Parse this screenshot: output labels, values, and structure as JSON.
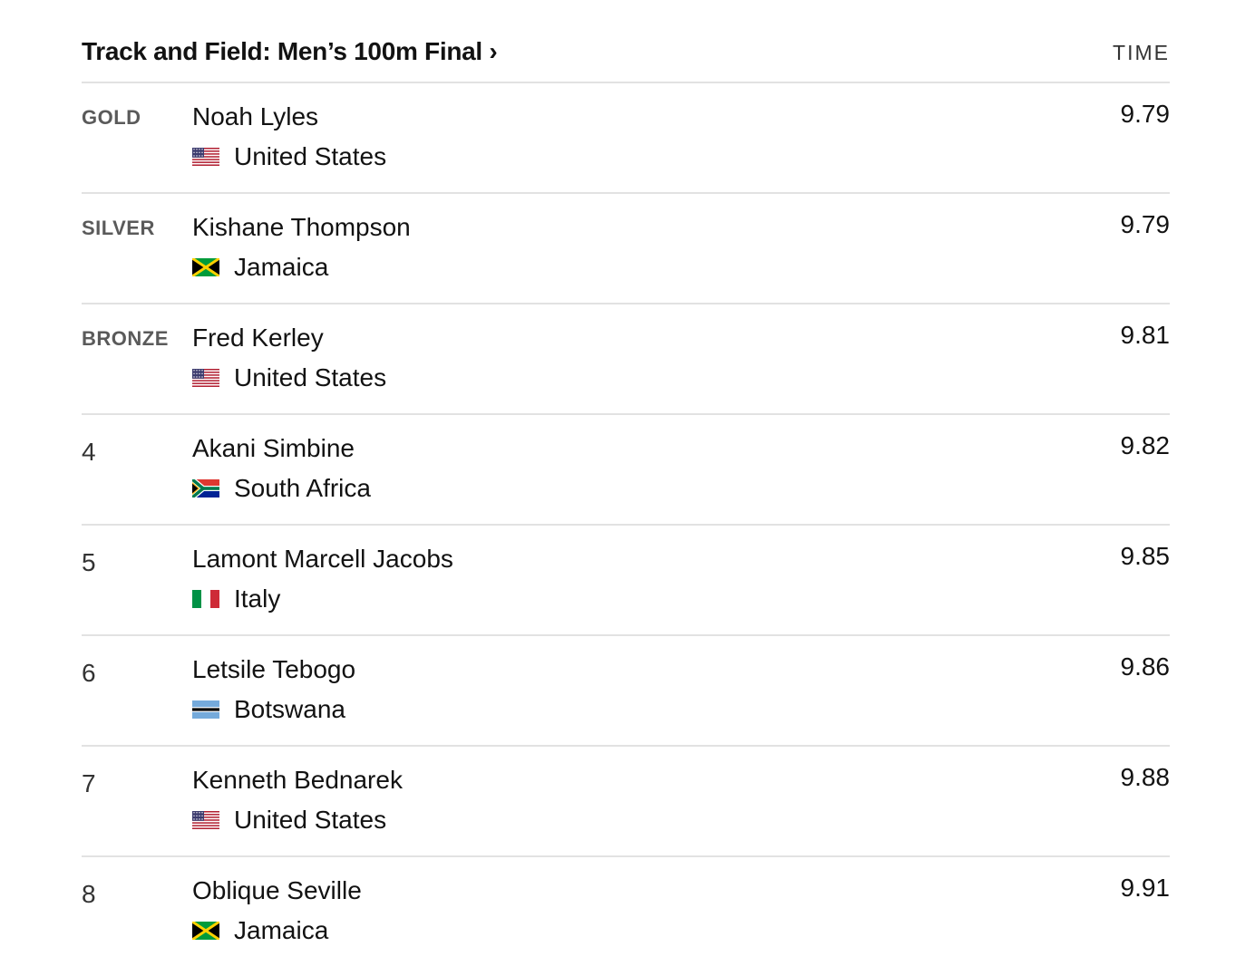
{
  "header": {
    "title": "Track and Field: Men’s 100m Final ›",
    "time_label": "TIME"
  },
  "results": [
    {
      "place": "GOLD",
      "athlete": "Noah Lyles",
      "country": "United States",
      "flag": "us-flag-icon",
      "time": "9.79"
    },
    {
      "place": "SILVER",
      "athlete": "Kishane Thompson",
      "country": "Jamaica",
      "flag": "jamaica-flag-icon",
      "time": "9.79"
    },
    {
      "place": "BRONZE",
      "athlete": "Fred Kerley",
      "country": "United States",
      "flag": "us-flag-icon",
      "time": "9.81"
    },
    {
      "place": "4",
      "athlete": "Akani Simbine",
      "country": "South Africa",
      "flag": "south-africa-flag-icon",
      "time": "9.82"
    },
    {
      "place": "5",
      "athlete": "Lamont Marcell Jacobs",
      "country": "Italy",
      "flag": "italy-flag-icon",
      "time": "9.85"
    },
    {
      "place": "6",
      "athlete": "Letsile Tebogo",
      "country": "Botswana",
      "flag": "botswana-flag-icon",
      "time": "9.86"
    },
    {
      "place": "7",
      "athlete": "Kenneth Bednarek",
      "country": "United States",
      "flag": "us-flag-icon",
      "time": "9.88"
    },
    {
      "place": "8",
      "athlete": "Oblique Seville",
      "country": "Jamaica",
      "flag": "jamaica-flag-icon",
      "time": "9.91"
    }
  ]
}
